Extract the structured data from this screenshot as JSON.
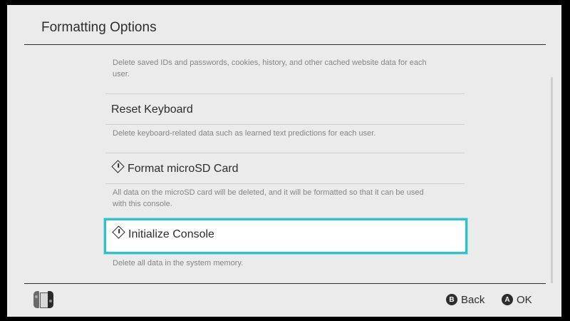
{
  "header": {
    "title": "Formatting Options"
  },
  "options": [
    {
      "label": "",
      "description_lines": [
        "Delete saved IDs and passwords, cookies, history, and other cached website data for each",
        "user."
      ]
    },
    {
      "label": "Reset Keyboard",
      "description_lines": [
        "Delete keyboard-related data such as learned text predictions for each user."
      ]
    },
    {
      "label": "Format microSD Card",
      "icon": "warning-icon",
      "description_lines": [
        "All data on the microSD card will be deleted, and it will be formatted so that it can be used",
        "with this console."
      ]
    },
    {
      "label": "Initialize Console",
      "icon": "warning-icon",
      "selected": true,
      "description_lines": [
        "Delete all data in the system memory."
      ]
    }
  ],
  "footer": {
    "back": {
      "key": "B",
      "label": "Back"
    },
    "ok": {
      "key": "A",
      "label": "OK"
    }
  },
  "colors": {
    "background": "#ebebeb",
    "text": "#2d2d2d",
    "muted": "#858585",
    "selection": "#2fc1cc"
  }
}
